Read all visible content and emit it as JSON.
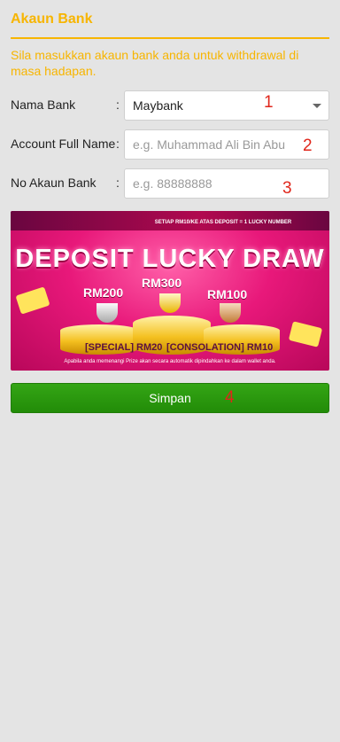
{
  "header": {
    "title": "Akaun Bank"
  },
  "note": "Sila masukkan akaun bank anda untuk withdrawal di masa hadapan.",
  "form": {
    "bank": {
      "label": "Nama Bank",
      "colon": ":",
      "value": "Maybank"
    },
    "fullname": {
      "label": "Account Full Name",
      "colon": ":",
      "placeholder": "e.g. Muhammad Ali Bin Abu"
    },
    "account": {
      "label": "No Akaun Bank",
      "colon": ":",
      "placeholder": "e.g. 88888888"
    }
  },
  "annotations": {
    "a1": "1",
    "a2": "2",
    "a3": "3",
    "a4": "4"
  },
  "banner": {
    "topline": "SETIAP RM10/KE ATAS DEPOSIT = 1 LUCKY NUMBER",
    "title": "DEPOSIT LUCKY DRAW",
    "prize_2": "RM200",
    "prize_1": "RM300",
    "prize_3": "RM100",
    "special": "[SPECIAL] RM20",
    "consolation": "[CONSOLATION] RM10",
    "footline": "Apabila anda memenangi Prize akan secara automatik dipindahkan ke dalam wallet anda."
  },
  "submit_label": "Simpan"
}
